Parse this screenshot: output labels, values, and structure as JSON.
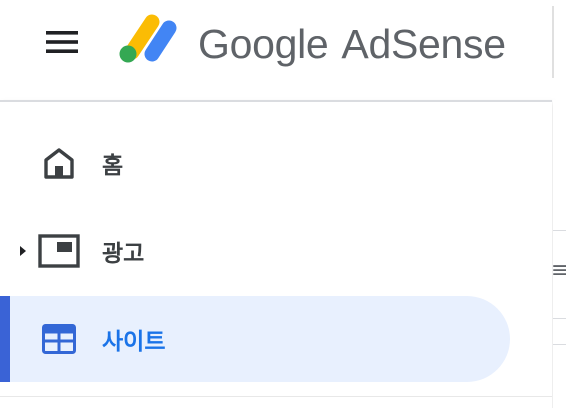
{
  "header": {
    "menu_icon": "hamburger-menu-icon",
    "logo_icon": "adsense-logo-icon",
    "brand_google": "Google",
    "brand_product": "AdSense"
  },
  "sidebar": {
    "items": [
      {
        "label": "홈",
        "icon": "home-icon",
        "active": false,
        "expandable": false
      },
      {
        "label": "광고",
        "icon": "ad-unit-icon",
        "active": false,
        "expandable": true
      },
      {
        "label": "사이트",
        "icon": "web-layout-icon",
        "active": true,
        "expandable": false
      }
    ]
  },
  "colors": {
    "active_background": "#e8f0fe",
    "active_indicator": "#3a63d6",
    "active_text": "#1a73e8",
    "text": "#3c4043",
    "icon": "#3c4043",
    "logo_yellow": "#fbbc04",
    "logo_blue": "#4285f4",
    "logo_green": "#34a853"
  }
}
